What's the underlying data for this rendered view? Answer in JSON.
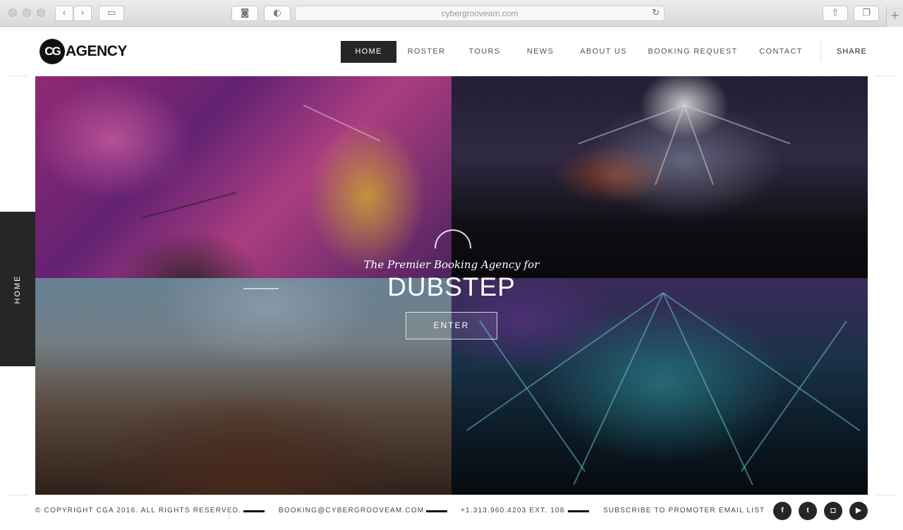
{
  "browser": {
    "url": "cybergrooveam.com",
    "new_tab_glyph": "+"
  },
  "logo": {
    "mark": "CG",
    "word": "AGENCY"
  },
  "nav": {
    "items": [
      {
        "label": "HOME",
        "active": true
      },
      {
        "label": "ROSTER",
        "active": false
      },
      {
        "label": "TOURS",
        "active": false
      },
      {
        "label": "NEWS",
        "active": false
      },
      {
        "label": "ABOUT US",
        "active": false
      },
      {
        "label": "BOOKING REQUEST",
        "active": false
      },
      {
        "label": "CONTACT",
        "active": false
      }
    ],
    "share_label": "SHARE"
  },
  "hero": {
    "tagline": "The Premier Booking Agency for",
    "headline": "DUBSTEP",
    "enter_label": "ENTER"
  },
  "side_tab": {
    "label": "HOME"
  },
  "footer": {
    "copyright": "© COPYRIGHT CGA 2016. ALL RIGHTS RESERVED.",
    "email": "BOOKING@CYBERGROOVEAM.COM",
    "phone": "+1.313.960.4203 EXT. 108",
    "subscribe": "SUBSCRIBE TO PROMOTER EMAIL LIST",
    "social": [
      {
        "icon": "facebook-icon",
        "glyph": "f"
      },
      {
        "icon": "twitter-icon",
        "glyph": "t"
      },
      {
        "icon": "instagram-icon",
        "glyph": "◻"
      },
      {
        "icon": "youtube-icon",
        "glyph": "▶"
      }
    ]
  }
}
